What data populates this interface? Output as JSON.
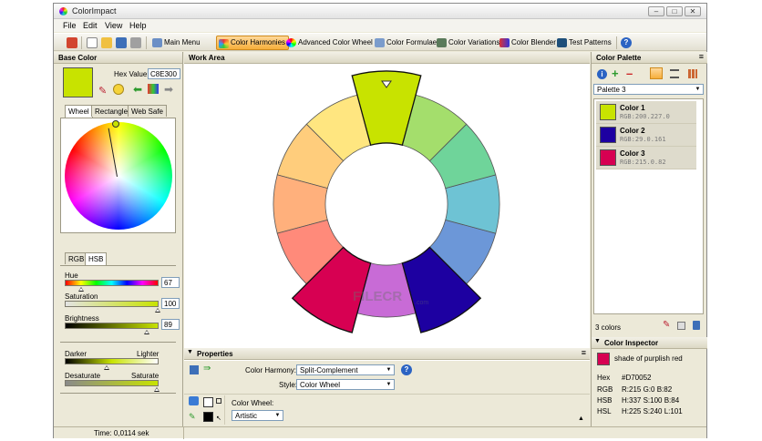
{
  "window": {
    "title": "ColorImpact"
  },
  "menu": [
    "File",
    "Edit",
    "View",
    "Help"
  ],
  "toolbar": {
    "buttons": [
      {
        "label": "Main Menu",
        "icon": "book-icon"
      },
      {
        "label": "Color Harmonies",
        "icon": "harmony-icon",
        "active": true
      },
      {
        "label": "Advanced Color Wheel",
        "icon": "color-wheel-icon"
      },
      {
        "label": "Color Formulae",
        "icon": "formula-icon"
      },
      {
        "label": "Color Variations",
        "icon": "variations-icon"
      },
      {
        "label": "Color Blender",
        "icon": "blender-icon"
      },
      {
        "label": "Test Patterns",
        "icon": "test-patterns-icon"
      }
    ]
  },
  "base_color": {
    "header": "Base Color",
    "hex_label": "Hex Value:",
    "hex_value": "C8E300",
    "color": "#c8e300",
    "tabs": [
      "Wheel",
      "Rectangle",
      "Web Safe"
    ],
    "mode_tabs": [
      "RGB",
      "HSB"
    ],
    "sliders": [
      {
        "label": "Hue",
        "value": "67",
        "fraction": 0.17
      },
      {
        "label": "Saturation",
        "value": "100",
        "fraction": 1.0
      },
      {
        "label": "Brightness",
        "value": "89",
        "fraction": 0.89
      }
    ],
    "adjust": {
      "darker": "Darker",
      "lighter": "Lighter",
      "desaturate": "Desaturate",
      "saturate": "Saturate"
    }
  },
  "work_area": {
    "header": "Work Area",
    "watermark": "FILECR",
    "watermark_suffix": ".com"
  },
  "properties": {
    "header": "Properties",
    "harmony_label": "Color Harmony:",
    "harmony_value": "Split-Complement",
    "style_label": "Style:",
    "style_value": "Color Wheel",
    "wheel_label": "Color Wheel:",
    "wheel_value": "Artistic"
  },
  "palette": {
    "header": "Color Palette",
    "selected": "Palette 3",
    "colors": [
      {
        "name": "Color 1",
        "value": "RGB:200.227.0",
        "hex": "#c8e300"
      },
      {
        "name": "Color 2",
        "value": "RGB:29.0.161",
        "hex": "#1d00a1"
      },
      {
        "name": "Color 3",
        "value": "RGB:215.0.82",
        "hex": "#d70052"
      }
    ],
    "count": "3 colors"
  },
  "inspector": {
    "header": "Color Inspector",
    "swatch": "#d70052",
    "description": "shade of purplish red",
    "rows": [
      {
        "k": "Hex",
        "v": "#D70052"
      },
      {
        "k": "RGB",
        "v": "R:215 G:0 B:82"
      },
      {
        "k": "HSB",
        "v": "H:337 S:100 B:84"
      },
      {
        "k": "HSL",
        "v": "H:225 S:240 L:101"
      }
    ]
  },
  "status": {
    "time": "Time: 0,0114 sek"
  }
}
